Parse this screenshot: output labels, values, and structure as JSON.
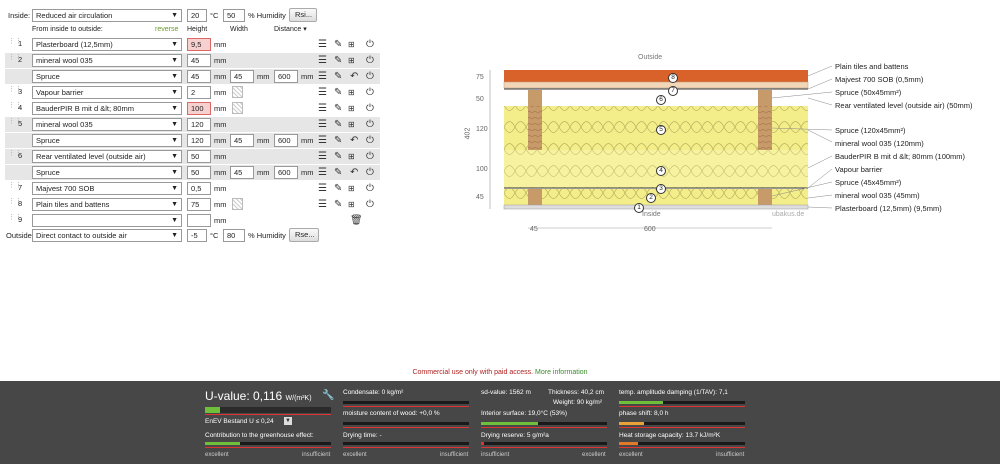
{
  "inside": {
    "label": "Inside:",
    "climate_option": "Reduced air circulation",
    "temperature": "20",
    "temp_unit": "°C",
    "humidity": "50",
    "humidity_unit": "% Humidity",
    "rsi_button": "Rsi..."
  },
  "headers": {
    "from_inside": "From inside to outside:",
    "reverse": "reverse",
    "height": "Height",
    "width": "Width",
    "distance": "Distance",
    "distance_arrow": "▾"
  },
  "units": {
    "mm": "mm"
  },
  "layers": [
    {
      "num": "1",
      "material": "Plasterboard (12,5mm)",
      "height": "9,5",
      "height_invalid": true
    },
    {
      "num": "2",
      "material": "mineral wool 035",
      "height": "45",
      "sub_material": "Spruce",
      "sub_height": "45",
      "sub_width": "45",
      "sub_distance": "600"
    },
    {
      "num": "3",
      "material": "Vapour barrier",
      "height": "2"
    },
    {
      "num": "4",
      "material": "BauderPIR B mit d &lt; 80mm",
      "height": "100",
      "height_invalid": true
    },
    {
      "num": "5",
      "material": "mineral wool 035",
      "height": "120",
      "sub_material": "Spruce",
      "sub_height": "120",
      "sub_width": "45",
      "sub_distance": "600"
    },
    {
      "num": "6",
      "material": "Rear ventilated level (outside air)",
      "height": "50",
      "sub_material": "Spruce",
      "sub_height": "50",
      "sub_width": "45",
      "sub_distance": "600"
    },
    {
      "num": "7",
      "material": "Majvest 700 SOB",
      "height": "0,5"
    },
    {
      "num": "8",
      "material": "Plain tiles and battens",
      "height": "75"
    },
    {
      "num": "9",
      "material": "",
      "height": ""
    }
  ],
  "outside": {
    "label": "Outside",
    "climate_option": "Direct contact to outside air",
    "temperature": "-5",
    "temp_unit": "°C",
    "humidity": "80",
    "humidity_unit": "% Humidity",
    "rse_button": "Rse..."
  },
  "drawing": {
    "outside_label": "Outside",
    "inside_label": "Inside",
    "watermark": "ubakus.de",
    "left_dims": [
      "75",
      "50",
      "120",
      "100",
      "45"
    ],
    "total_dim": "402",
    "bottom_dims": [
      "45",
      "600"
    ],
    "layer_labels": [
      "Plain tiles and battens",
      "Majvest 700 SOB (0,5mm)",
      "Spruce (50x45mm²)",
      "Rear ventilated level (outside air) (50mm)",
      "Spruce (120x45mm²)",
      "mineral wool 035 (120mm)",
      "BauderPIR B mit d &lt; 80mm (100mm)",
      "Vapour barrier",
      "Spruce (45x45mm²)",
      "mineral wool 035 (45mm)",
      "Plasterboard (12,5mm) (9,5mm)"
    ],
    "colors": {
      "tiles": "#d9622b",
      "insulation": "#f4ee8a",
      "wood": "#c79a6a",
      "pir": "#f6f2a0"
    }
  },
  "notice": {
    "text": "Commercial use only with paid access.",
    "link": "More information"
  },
  "results": {
    "u_label": "U-value:",
    "u_value": "0,116",
    "u_unit": "W/(m²K)",
    "u_fraction": 0.12,
    "enev": "EnEV Bestand U ≤ 0,24",
    "greenhouse": "Contribution to the greenhouse effect:",
    "greenhouse_fraction": 0.28,
    "condensate": "Condensate: 0 kg/m²",
    "moisture": "moisture content of wood: +0,0 %",
    "drying_time": "Drying time: -",
    "sd_value": "sd-value: 1562 m",
    "thickness": "Thickness: 40,2 cm",
    "weight": "Weight: 90 kg/m²",
    "interior_surface": "Interior surface: 19,0°C (53%)",
    "interior_fraction": 0.45,
    "drying_reserve": "Drying reserve: 5 g/m²a",
    "drying_reserve_fraction": 0.02,
    "temp_amp": "temp. amplitude damping (1/TAV): 7,1",
    "temp_amp_fraction": 0.35,
    "phase_shift": "phase shift: 8,0 h",
    "phase_fraction": 0.2,
    "heat_storage": "Heat storage capacity: 13.7 kJ/m²K",
    "heat_fraction": 0.15,
    "scale_good": "excellent",
    "scale_bad": "insufficient"
  }
}
